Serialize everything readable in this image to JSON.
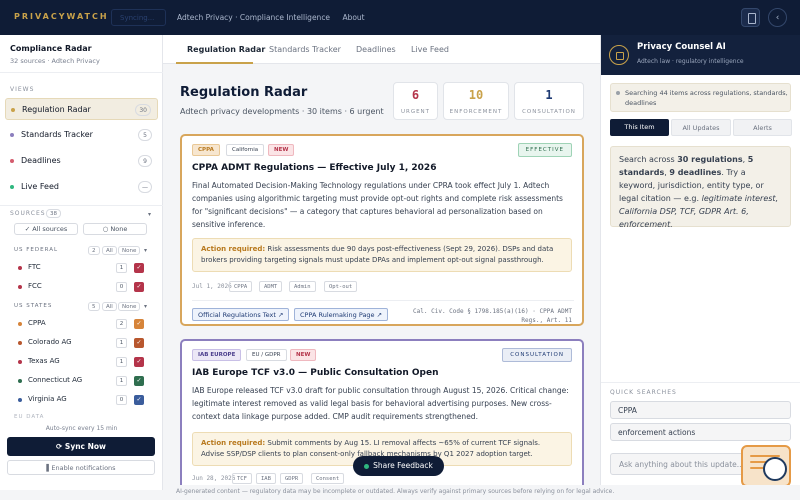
{
  "topbar": {
    "logo": "PRIVACYWATCH",
    "sync_ghost": "Syncing...",
    "nav": [
      "Adtech Privacy · Compliance Intelligence",
      "About"
    ]
  },
  "sidebar": {
    "title": "Compliance Radar",
    "subtitle": "32 sources · Adtech Privacy",
    "views_caption": "VIEWS",
    "views": [
      {
        "label": "Regulation Radar",
        "count": "30",
        "color": "#c9a24a"
      },
      {
        "label": "Standards Tracker",
        "count": "5",
        "color": "#8c7fbe"
      },
      {
        "label": "Deadlines",
        "count": "9",
        "color": "#d45c6e"
      },
      {
        "label": "Live Feed",
        "count": "—",
        "color": "#2fb77f"
      }
    ],
    "sources_caption": "SOURCES",
    "sources_count": "38",
    "all_sources": "✓ All sources",
    "none": "○ None",
    "groups": [
      {
        "name": "US FEDERAL",
        "count": "2",
        "all": "All",
        "none": "None",
        "items": [
          {
            "name": "FTC",
            "count": "1",
            "color": "#b4344a"
          },
          {
            "name": "FCC",
            "count": "0",
            "color": "#b4344a"
          }
        ]
      },
      {
        "name": "US STATES",
        "count": "5",
        "all": "All",
        "none": "None",
        "items": [
          {
            "name": "CPPA",
            "count": "2",
            "color": "#d6843a"
          },
          {
            "name": "Colorado AG",
            "count": "1",
            "color": "#b8572e"
          },
          {
            "name": "Texas AG",
            "count": "1",
            "color": "#b4344a"
          },
          {
            "name": "Connecticut AG",
            "count": "1",
            "color": "#2f6e4f"
          },
          {
            "name": "Virginia AG",
            "count": "0",
            "color": "#3b5d9c"
          }
        ]
      }
    ],
    "eu_caption": "EU DATA",
    "auto_sync": "Auto-sync every 15 min",
    "sync_now": "⟳ Sync Now",
    "notifications": "▌Enable notifications"
  },
  "main": {
    "tabs": [
      "Regulation Radar",
      "Standards Tracker",
      "Deadlines",
      "Live Feed"
    ],
    "title": "Regulation Radar",
    "subtitle": "Adtech privacy developments · 30 items · 6 urgent",
    "stats": [
      {
        "value": "6",
        "label": "URGENT",
        "color": "#b4344a"
      },
      {
        "value": "10",
        "label": "ENFORCEMENT",
        "color": "#c9a24a"
      },
      {
        "value": "1",
        "label": "CONSULTATION",
        "color": "#1e3a73"
      }
    ],
    "cards": [
      {
        "tags": [
          "CPPA",
          "California",
          "NEW"
        ],
        "status": "EFFECTIVE",
        "title": "CPPA ADMT Regulations — Effective July 1, 2026",
        "body": "Final Automated Decision-Making Technology regulations under CPRA took effect July 1. Adtech companies using algorithmic targeting must provide opt-out rights and complete risk assessments for \"significant decisions\" — a category that captures behavioral ad personalization based on sensitive inference.",
        "action_label": "Action required:",
        "action_text": " Risk assessments due 90 days post-effectiveness (Sept 29, 2026). DSPs and data brokers providing targeting signals must update DPAs and implement opt-out signal passthrough.",
        "date": "Jul 1, 2026",
        "chips": [
          "CPPA",
          "ADMT",
          "Admin",
          "Opt-out"
        ],
        "links": [
          "Official Regulations Text ↗",
          "CPPA Rulemaking Page ↗"
        ],
        "cite_1": "Cal. Civ. Code § 1798.185(a)(16) · CPPA ADMT",
        "cite_2": "Regs., Art. 11"
      },
      {
        "tags": [
          "IAB EUROPE",
          "EU / GDPR",
          "NEW"
        ],
        "status": "CONSULTATION",
        "title": "IAB Europe TCF v3.0 — Public Consultation Open",
        "body": "IAB Europe released TCF v3.0 draft for public consultation through August 15, 2026. Critical change: legitimate interest removed as valid legal basis for behavioral advertising purposes. New cross-context data linkage purpose added. CMP audit requirements strengthened.",
        "action_label": "Action required:",
        "action_text": " Submit comments by Aug 15. LI removal affects ~65% of current TCF signals. Advise SSP/DSP clients to plan consent-only fallback mechanisms by Q1 2027 adoption target.",
        "date": "Jun 28, 2026",
        "chips": [
          "TCF",
          "IAB",
          "GDPR",
          "Consent"
        ]
      }
    ],
    "share": "Share Feedback"
  },
  "assistant": {
    "title": "Privacy Counsel AI",
    "subtitle": "Adtech law · regulatory intelligence",
    "search_status": "Searching 44 items across regulations, standards, deadlines",
    "segments": [
      "This Item",
      "All Updates",
      "Alerts"
    ],
    "msg_1": "Search across ",
    "msg_b1": "30 regulations",
    "msg_2": ", ",
    "msg_b2": "5 standards",
    "msg_3": ", ",
    "msg_b3": "9 deadlines",
    "msg_4": ". Try a keyword, jurisdiction, entity type, or legal citation — e.g. ",
    "msg_e": "legitimate interest, California DSP, TCF, GDPR Art. 6, enforcement.",
    "quick_caption": "QUICK SEARCHES",
    "quick": [
      "CPPA",
      "enforcement actions"
    ],
    "input_placeholder": "Ask anything about this update..."
  },
  "disclaimer": "AI-generated content — regulatory data may be incomplete or outdated. Always verify against primary sources before relying on for legal advice."
}
